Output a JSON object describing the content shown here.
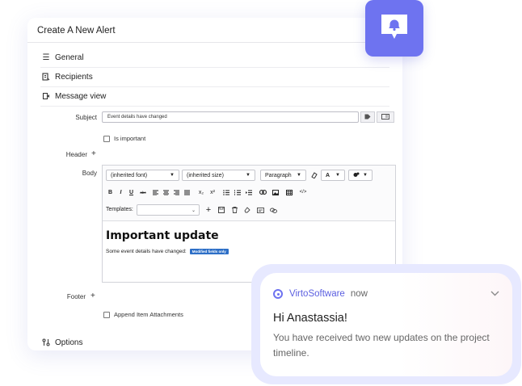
{
  "window": {
    "title": "Create A New Alert"
  },
  "sections": [
    {
      "label": "General",
      "icon": "list-icon"
    },
    {
      "label": "Recipients",
      "icon": "recipients-icon"
    },
    {
      "label": "Message view",
      "icon": "message-view-icon"
    }
  ],
  "options_section": {
    "label": "Options",
    "icon": "options-icon"
  },
  "form": {
    "subject_label": "Subject",
    "subject_value": "Event details have changed",
    "is_important_label": "Is important",
    "is_important_checked": false,
    "header_label": "Header",
    "body_label": "Body",
    "footer_label": "Footer",
    "append_attachments_label": "Append Item Attachments",
    "append_attachments_checked": false
  },
  "editor": {
    "font_select": "(inherited font)",
    "size_select": "(inherited size)",
    "block_select": "Paragraph",
    "font_color_label": "A",
    "templates_label": "Templates:",
    "templates_value": "",
    "heading": "Important update",
    "line_text": "Some event details have changed:",
    "badge_text": "Modified fields only",
    "format_buttons": [
      "B",
      "I",
      "U",
      "abc",
      "align-left",
      "align-center",
      "align-right",
      "justify",
      "x₂",
      "x²",
      "bulleted-list",
      "numbered-list",
      "indent",
      "link",
      "image",
      "table",
      "code"
    ]
  },
  "notification": {
    "app": "VirtoSoftware",
    "time": "now",
    "title": "Hi Anastassia!",
    "body": "You have received two new updates on the project timeline."
  },
  "colors": {
    "accent": "#6e73f0",
    "badge": "#2d6fc7",
    "notification_ring": "#e7e9ff"
  }
}
